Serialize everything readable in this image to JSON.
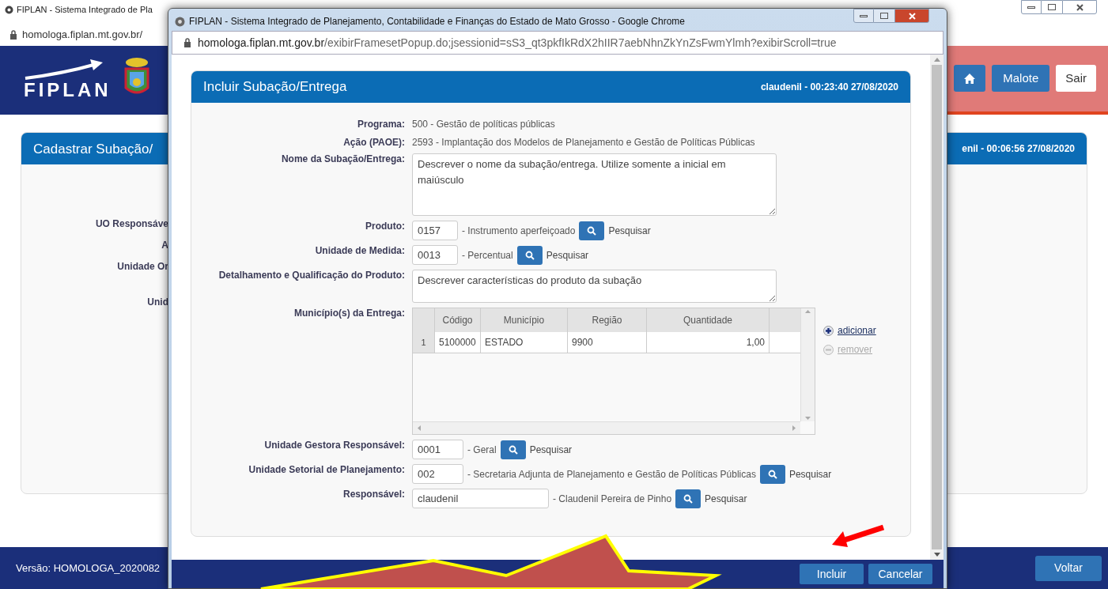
{
  "background_window": {
    "title": "FIPLAN - Sistema Integrado de Pla",
    "address": "homologa.fiplan.mt.gov.br/",
    "logo": "FIPLAN",
    "header_buttons": [
      "Malote",
      "Sair"
    ],
    "card": {
      "title": "Cadastrar Subação/",
      "user_time": "enil - 00:06:56 27/08/2020",
      "labels": [
        "UO Responsáve",
        "A",
        "Unidade Or",
        "Unid"
      ]
    },
    "version": "Versão: HOMOLOGA_2020082",
    "back_button": "Voltar"
  },
  "popup": {
    "title": "FIPLAN - Sistema Integrado de Planejamento, Contabilidade e Finanças do Estado de Mato Grosso - Google Chrome",
    "address_host": "homologa.fiplan.mt.gov.br",
    "address_path": "/exibirFramesetPopup.do;jsessionid=sS3_qt3pkfIkRdX2hIIR7aebNhnZkYnZsFwmYlmh?exibirScroll=true",
    "panel": {
      "title": "Incluir Subação/Entrega",
      "user_time": "claudenil - 00:23:40 27/08/2020",
      "fields": [
        {
          "kind": "info",
          "label": "Programa:",
          "value": "500 - Gestão de políticas públicas"
        },
        {
          "kind": "info",
          "label": "Ação (PAOE):",
          "value": "2593 - Implantação dos Modelos de Planejamento e Gestão de Políticas Públicas"
        },
        {
          "kind": "textarea",
          "label": "Nome da Subação/Entrega:",
          "value": "Descrever o nome da subação/entrega. Utilize somente a inicial em maiúsculo"
        },
        {
          "kind": "lookup",
          "label": "Produto:",
          "value": "0157",
          "description": "- Instrumento aperfeiçoado",
          "search": "Pesquisar"
        },
        {
          "kind": "lookup",
          "label": "Unidade de Medida:",
          "value": "0013",
          "description": "- Percentual",
          "search": "Pesquisar"
        },
        {
          "kind": "textarea",
          "label": "Detalhamento e Qualificação do Produto:",
          "value": "Descrever características do produto da subação"
        },
        {
          "kind": "table",
          "label": "Município(s) da Entrega:",
          "columns": [
            "Código",
            "Município",
            "Região",
            "Quantidade"
          ],
          "rows": [
            {
              "number": "1",
              "cells": [
                "5100000",
                "ESTADO",
                "9900",
                "1,00"
              ]
            }
          ],
          "actions": [
            {
              "label": "adicionar",
              "disabled": false
            },
            {
              "label": "remover",
              "disabled": true
            }
          ]
        },
        {
          "kind": "lookup",
          "label": "Unidade Gestora Responsável:",
          "value": "0001",
          "description": "- Geral",
          "search": "Pesquisar"
        },
        {
          "kind": "lookup",
          "label": "Unidade Setorial de Planejamento:",
          "value": "002",
          "description": "- Secretaria Adjunta de Planejamento e Gestão de Políticas Públicas",
          "search": "Pesquisar"
        },
        {
          "kind": "lookup",
          "label": "Responsável:",
          "value": "claudenil",
          "description": "- Claudenil Pereira de Pinho",
          "search": "Pesquisar"
        }
      ]
    },
    "buttons": [
      "Incluir",
      "Cancelar"
    ]
  }
}
